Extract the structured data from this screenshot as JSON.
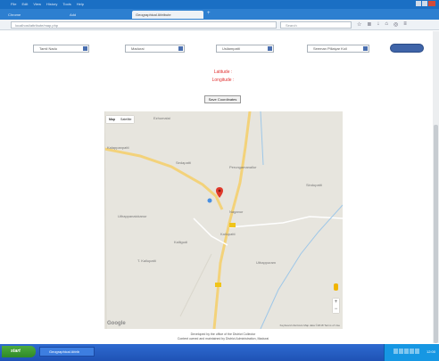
{
  "browser": {
    "menu": [
      "File",
      "Edit",
      "View",
      "History",
      "Tools",
      "Help"
    ],
    "tabs": [
      {
        "label": "Chrome"
      },
      {
        "label": "Add"
      },
      {
        "label": "Geographical Attribute"
      }
    ],
    "new_tab_symbol": "+",
    "url": "localhost/attribute/map.php",
    "search_placeholder": "Search"
  },
  "filters": {
    "state": "Tamil Nadu",
    "district": "Madurai",
    "block": "Usilampatti",
    "village": "Seeman Pillaiyar Koil"
  },
  "coords": {
    "latitude_label": "Latitude :",
    "longitude_label": "Longitude :"
  },
  "save_button": "Save Coordinates",
  "map": {
    "type_map": "Map",
    "type_satellite": "Satellite",
    "places": [
      "Ezhumalai",
      "Kalappanpatti",
      "Sedapatti",
      "Perungamanallur",
      "Sindupatti",
      "Uthappanaickanur",
      "Naganur",
      "Kallupatti",
      "Kalligudi",
      "T. Kallupatti",
      "Uthappuram"
    ],
    "road_badge": "SH",
    "road_badge_lower": "SH",
    "google": "Google",
    "attribution": "Keyboard shortcuts   Map data ©2018   Terms of Use"
  },
  "footer": {
    "line1": "Developed by the office of the District Collector",
    "line2": "Content owned and maintained by District Administration, Madurai"
  },
  "taskbar": {
    "start": "start",
    "item": "Geographical Attrib",
    "clock": "12:00"
  }
}
